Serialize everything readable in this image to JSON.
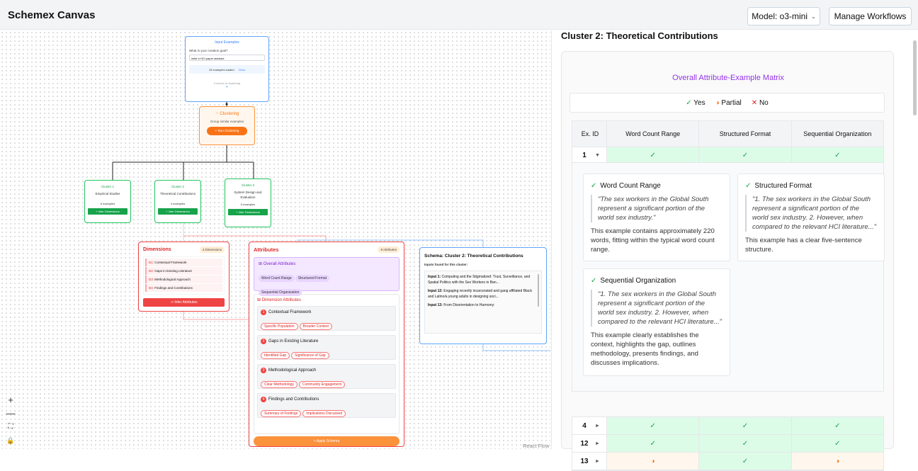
{
  "app": {
    "title": "Schemex Canvas"
  },
  "toolbar": {
    "model_label": "Model: o3-mini",
    "manage_label": "Manage Workflows"
  },
  "canvas": {
    "input_node": {
      "title": "Input Examples",
      "question": "What is your creation goal?",
      "goal_value": "write a HCI paper abstract",
      "loaded_text": "15 examples loaded",
      "clear_label": "Clear",
      "connect_text": "Connect to clustering",
      "plus": "+"
    },
    "cluster_node": {
      "title": "Clustering",
      "desc": "Group similar examples",
      "button": "Run Clustering"
    },
    "clusters": [
      {
        "title": "Cluster 1",
        "subtitle": "Empirical Studies",
        "count": "6 examples",
        "button": "Infer Dimensions"
      },
      {
        "title": "Cluster 2",
        "subtitle": "Theoretical Contributions",
        "count": "4 examples",
        "button": "Infer Dimensions"
      },
      {
        "title": "Cluster 3",
        "subtitle": "System Design and Evaluation",
        "count": "5 examples",
        "button": "Infer Dimensions"
      }
    ],
    "dimensions_node": {
      "title": "Dimensions",
      "badge": "4 Dimensions",
      "items": [
        {
          "id": "D1:",
          "label": "Contextual Framework"
        },
        {
          "id": "D2:",
          "label": "Gaps in Existing Literature"
        },
        {
          "id": "D3:",
          "label": "Methodological Approach"
        },
        {
          "id": "D4:",
          "label": "Findings and Contributions"
        }
      ],
      "button": "-> Infer Attributes"
    },
    "attributes_node": {
      "title": "Attributes",
      "badge": "8 Attributes",
      "overall_title": "Overall Attributes",
      "overall_tags": [
        "Word Count Range",
        "Structured Format",
        "Sequential Organization"
      ],
      "dimension_title": "Dimension Attributes",
      "dimensions": [
        {
          "num": "1",
          "name": "Contextual Framework",
          "tags": [
            "Specific Population",
            "Broader Context"
          ]
        },
        {
          "num": "2",
          "name": "Gaps in Existing Literature",
          "tags": [
            "Identified Gap",
            "Significance of Gap"
          ]
        },
        {
          "num": "3",
          "name": "Methodological Approach",
          "tags": [
            "Clear Methodology",
            "Community Engagement"
          ]
        },
        {
          "num": "4",
          "name": "Findings and Contributions",
          "tags": [
            "Summary of Findings",
            "Implications Discussed"
          ]
        }
      ],
      "apply_button": "+ Apply Schema"
    },
    "schema_node": {
      "title": "Schema: Cluster 2: Theoretical Contributions",
      "subtitle": "Inputs found for this cluster:",
      "inputs": [
        {
          "label": "Input 1:",
          "text": "Computing and the Stigmatized: Trust, Surveillance, and Spatial Politics with the Sex Workers in Ban..."
        },
        {
          "label": "Input 12:",
          "text": "Engaging recently incarcerated and gang affiliated Black and Latino/a young adults in designing soci..."
        },
        {
          "label": "Input 13:",
          "text": "From Disorientation to Harmony:"
        }
      ]
    },
    "attribution": "React Flow",
    "controls": {
      "zoom_in": "+",
      "zoom_out": "—",
      "fit": "⛶",
      "lock": "🔒"
    }
  },
  "panel": {
    "title": "Cluster 2: Theoretical Contributions",
    "matrix_title": "Overall Attribute-Example Matrix",
    "legend": {
      "yes": "Yes",
      "partial": "Partial",
      "no": "No",
      "yes_icon": "✓",
      "partial_icon": "◑",
      "no_icon": "✕"
    },
    "columns": [
      "Ex. ID",
      "Word Count Range",
      "Structured Format",
      "Sequential Organization"
    ],
    "rows": [
      {
        "id": "1",
        "toggle": "▼",
        "cells": [
          "✓",
          "✓",
          "✓"
        ],
        "status": [
          "yes",
          "yes",
          "yes"
        ]
      },
      {
        "id": "4",
        "toggle": "►",
        "cells": [
          "✓",
          "✓",
          "✓"
        ],
        "status": [
          "yes",
          "yes",
          "yes"
        ]
      },
      {
        "id": "12",
        "toggle": "►",
        "cells": [
          "✓",
          "✓",
          "✓"
        ],
        "status": [
          "yes",
          "yes",
          "yes"
        ]
      },
      {
        "id": "13",
        "toggle": "►",
        "cells": [
          "◑",
          "✓",
          "◑"
        ],
        "status": [
          "partial",
          "yes",
          "partial"
        ]
      }
    ],
    "expanded": [
      {
        "name": "Word Count Range",
        "quote": "\"The sex workers in the Global South represent a significant portion of the world sex industry.\"",
        "explanation": "This example contains approximately 220 words, fitting within the typical word count range."
      },
      {
        "name": "Structured Format",
        "quote": "\"1. The sex workers in the Global South represent a significant portion of the world sex industry. 2. However, when compared to the relevant HCI literature...\"",
        "explanation": "This example has a clear five-sentence structure."
      },
      {
        "name": "Sequential Organization",
        "quote": "\"1. The sex workers in the Global South represent a significant portion of the world sex industry. 2. However, when compared to the relevant HCI literature...\"",
        "explanation": "This example clearly establishes the context, highlights the gap, outlines methodology, presents findings, and discusses implications."
      }
    ],
    "colors": {
      "accent_purple": "#9333ea",
      "yes_green": "#16a34a",
      "partial_orange": "#f97316",
      "no_red": "#dc2626"
    }
  }
}
